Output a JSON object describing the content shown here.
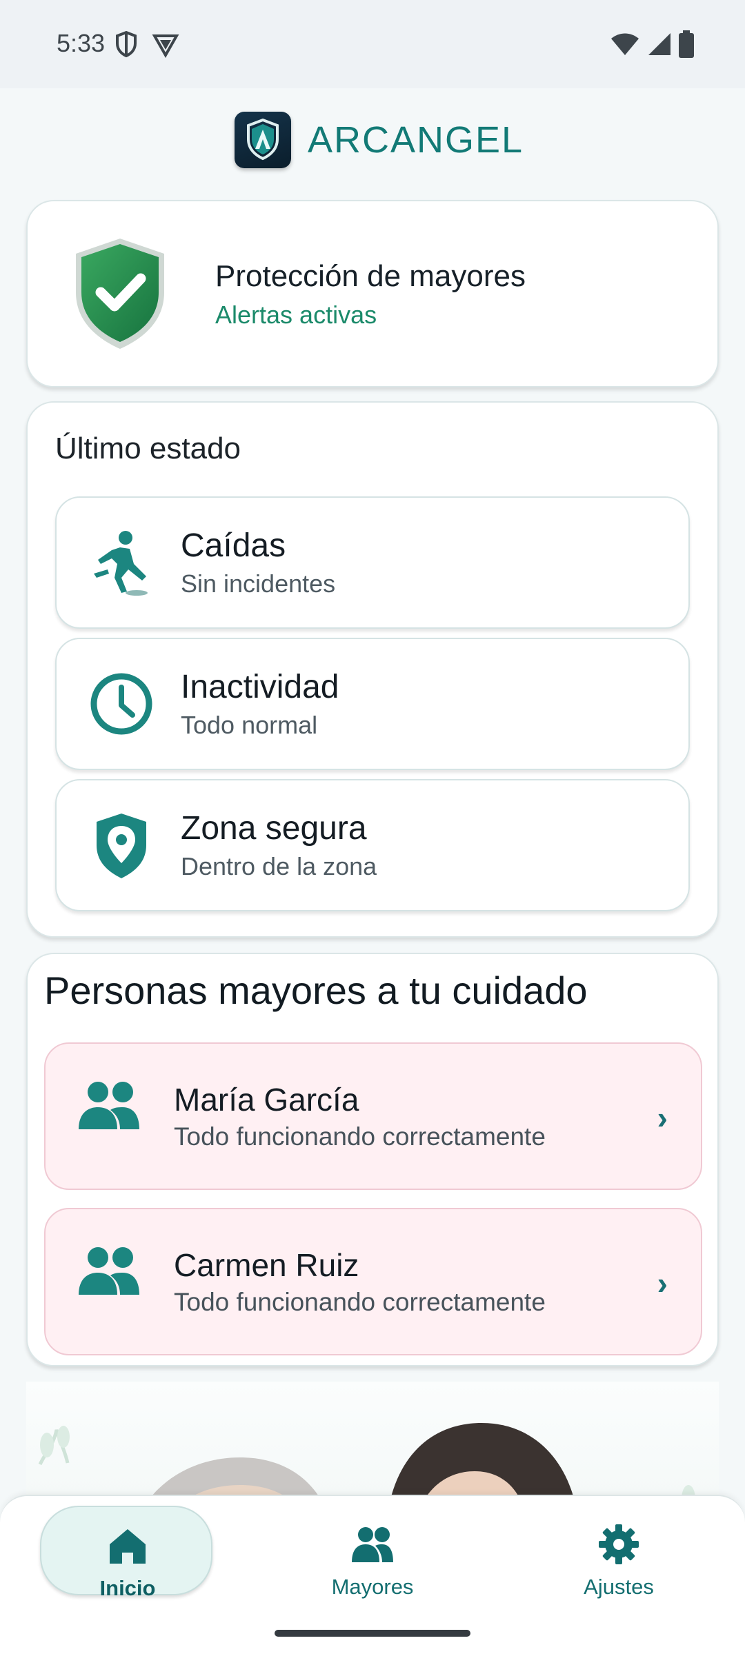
{
  "status_bar": {
    "time": "5:33",
    "left_icons": [
      "shield-outline-icon",
      "vpn-icon"
    ],
    "right_icons": [
      "wifi-icon",
      "signal-icon",
      "battery-icon"
    ]
  },
  "app": {
    "title": "ARCANGEL",
    "logo_icon": "arcangel-logo-icon",
    "accent": "#127a76"
  },
  "protection": {
    "title": "Protección de mayores",
    "subtitle": "Alertas activas",
    "icon": "check-shield-icon"
  },
  "status": {
    "heading": "Último estado",
    "items": [
      {
        "title": "Caídas",
        "subtitle": "Sin incidentes",
        "icon": "falling-person-icon"
      },
      {
        "title": "Inactividad",
        "subtitle": "Todo normal",
        "icon": "clock-icon"
      },
      {
        "title": "Zona segura",
        "subtitle": "Dentro de la zona",
        "icon": "location-shield-icon"
      }
    ]
  },
  "care": {
    "heading": "Personas mayores a tu cuidado",
    "people": [
      {
        "name": "María García",
        "status": "Todo funcionando correctamente",
        "chevron": "›"
      },
      {
        "name": "Carmen Ruiz",
        "status": "Todo funcionando correctamente",
        "chevron": "›"
      }
    ]
  },
  "nav": {
    "items": [
      {
        "label": "Inicio",
        "icon": "home-icon",
        "active": true
      },
      {
        "label": "Mayores",
        "icon": "people-icon",
        "active": false
      },
      {
        "label": "Ajustes",
        "icon": "gear-icon",
        "active": false
      }
    ]
  }
}
